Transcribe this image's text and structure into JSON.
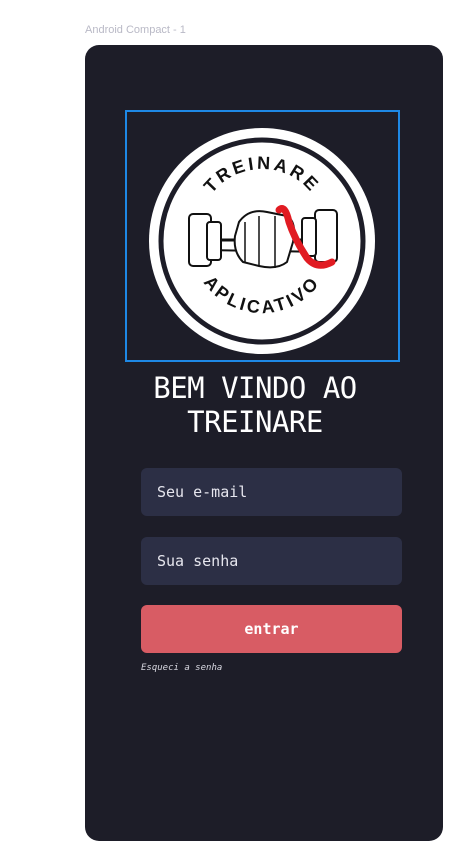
{
  "frame": {
    "label": "Android Compact - 1"
  },
  "logo": {
    "top_text": "TREINARE",
    "bottom_text": "APLICATIVO"
  },
  "welcome": {
    "line1": "BEM VINDO AO",
    "line2": "TREINARE"
  },
  "form": {
    "email_placeholder": "Seu e-mail",
    "password_placeholder": "Sua senha",
    "submit_label": "entrar",
    "forgot_link": "Esqueci a senha"
  },
  "colors": {
    "background": "#1d1d28",
    "input": "#2c2f45",
    "button": "#d85c64",
    "logo_border": "#1e88e5"
  }
}
